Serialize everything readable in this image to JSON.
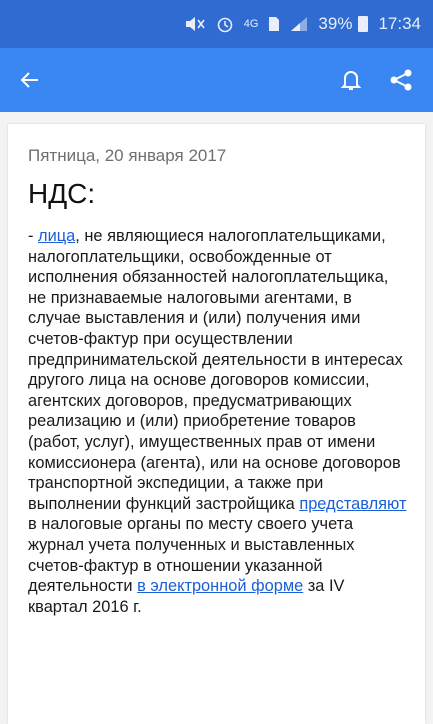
{
  "status_bar": {
    "network": "4G",
    "battery": "39%",
    "time": "17:34"
  },
  "app_bar": {
    "background": "#3a86f2"
  },
  "article": {
    "date": "Пятница, 20 января 2017",
    "title": "НДС:",
    "prefix": "- ",
    "link1": "лица",
    "text1": ", не являющиеся налогоплательщиками, налогоплательщики, освобожденные от исполнения обязанностей налогоплательщика, не признаваемые налоговыми агентами, в случае выставления и (или) получения ими счетов-фактур при осуществлении предпринимательской деятельности в интересах другого лица на основе договоров комиссии, агентских договоров, предусматривающих реализацию и (или) приобретение товаров (работ, услуг), имущественных прав от имени комиссионера (агента), или на основе договоров транспортной экспедиции, а также при выполнении функций застройщика ",
    "link2": "представляют",
    "text2": " в налоговые органы по месту своего учета журнал учета полученных и выставленных счетов-фактур в отношении указанной деятельности ",
    "link3": "в электронной форме",
    "text3": " за IV квартал 2016 г."
  }
}
